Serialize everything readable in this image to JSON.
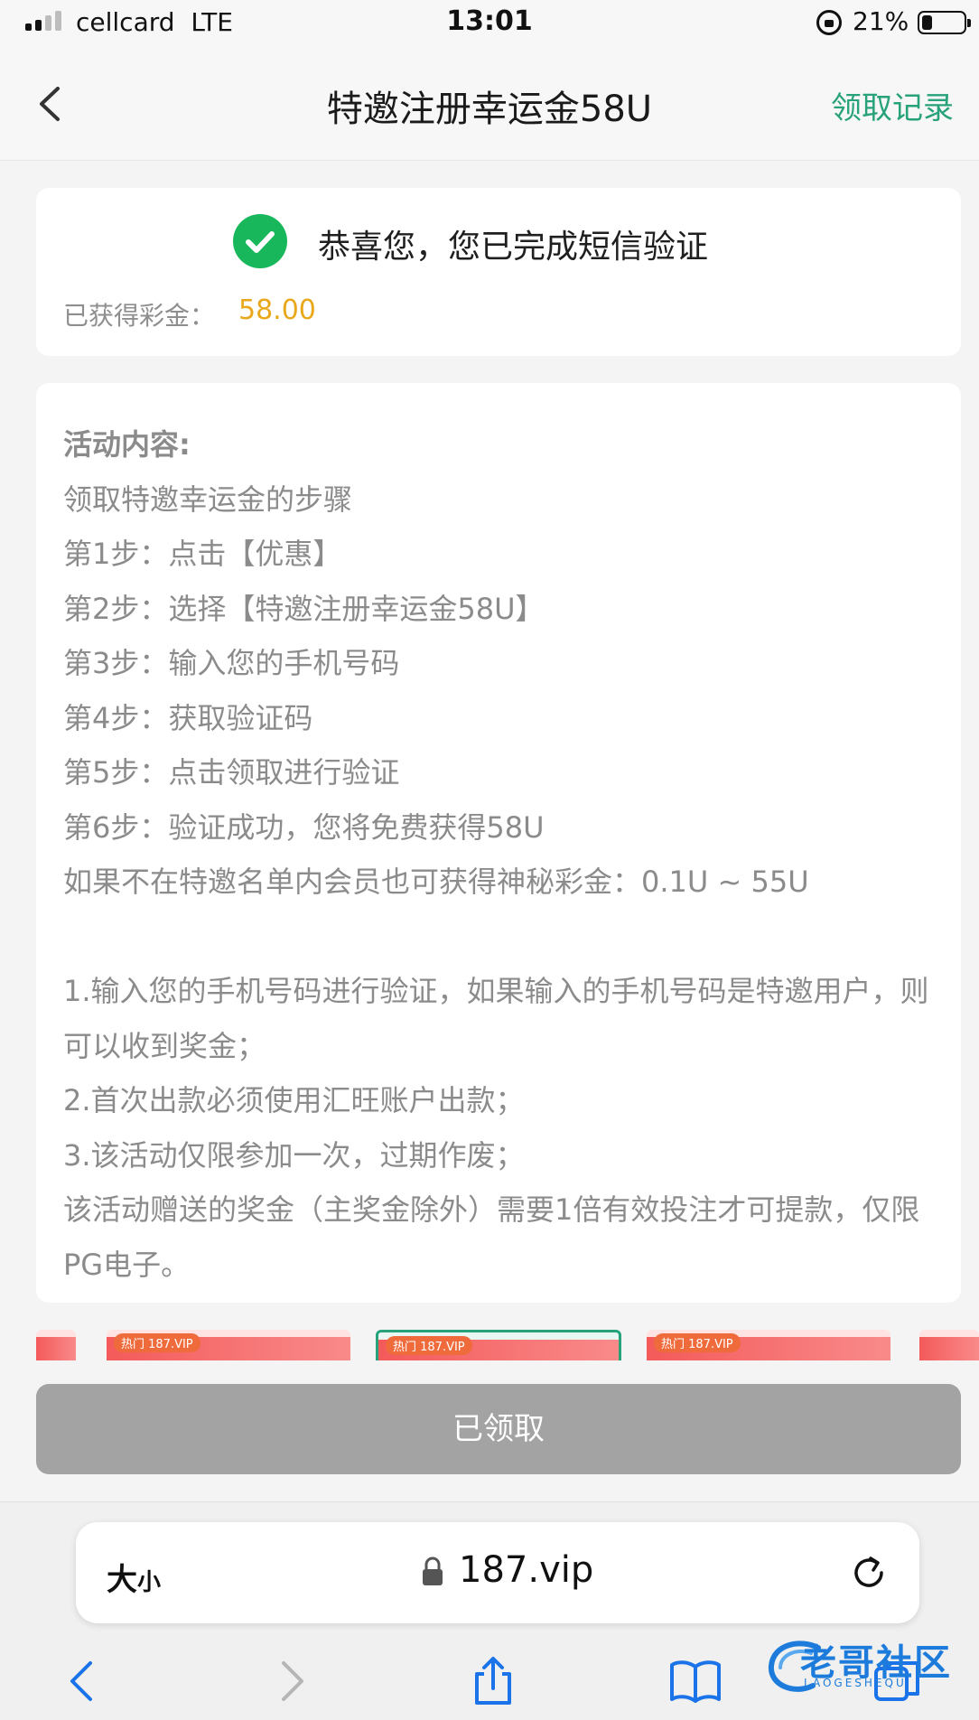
{
  "status_bar": {
    "carrier": "cellcard",
    "network": "LTE",
    "time": "13:01",
    "battery_percent": "21%"
  },
  "header": {
    "title": "特邀注册幸运金58U",
    "records_link": "领取记录"
  },
  "success_card": {
    "message": "恭喜您，您已完成短信验证",
    "earned_label": "已获得彩金：",
    "earned_value": "58.00"
  },
  "info_card": {
    "title": "活动内容:",
    "lines": [
      "领取特邀幸运金的步骤",
      "第1步：点击【优惠】",
      "第2步：选择【特邀注册幸运金58U】",
      "第3步：输入您的手机号码",
      "第4步：获取验证码",
      "第5步：点击领取进行验证",
      "第6步：验证成功，您将免费获得58U",
      "如果不在特邀名单内会员也可获得神秘彩金：0.1U ~ 55U"
    ],
    "rules": [
      "1.输入您的手机号码进行验证，如果输入的手机号码是特邀用户，则可以收到奖金；",
      "2.首次出款必须使用汇旺账户出款；",
      "3.该活动仅限参加一次，过期作废；",
      "该活动赠送的奖金（主奖金除外）需要1倍有效投注才可提款，仅限PG电子。"
    ]
  },
  "banners": {
    "tag": "热门 187.VIP"
  },
  "claim_button": {
    "label": "已领取"
  },
  "browser": {
    "text_size_label": "大",
    "text_size_small": "小",
    "url": "187.vip"
  },
  "watermark": {
    "text": "老哥社区",
    "sub": "LAOGESHEQU"
  },
  "colors": {
    "accent_green": "#27a27a",
    "success_green": "#19b75b",
    "amount_gold": "#e9a81b",
    "disabled_button": "#a3a3a3"
  }
}
